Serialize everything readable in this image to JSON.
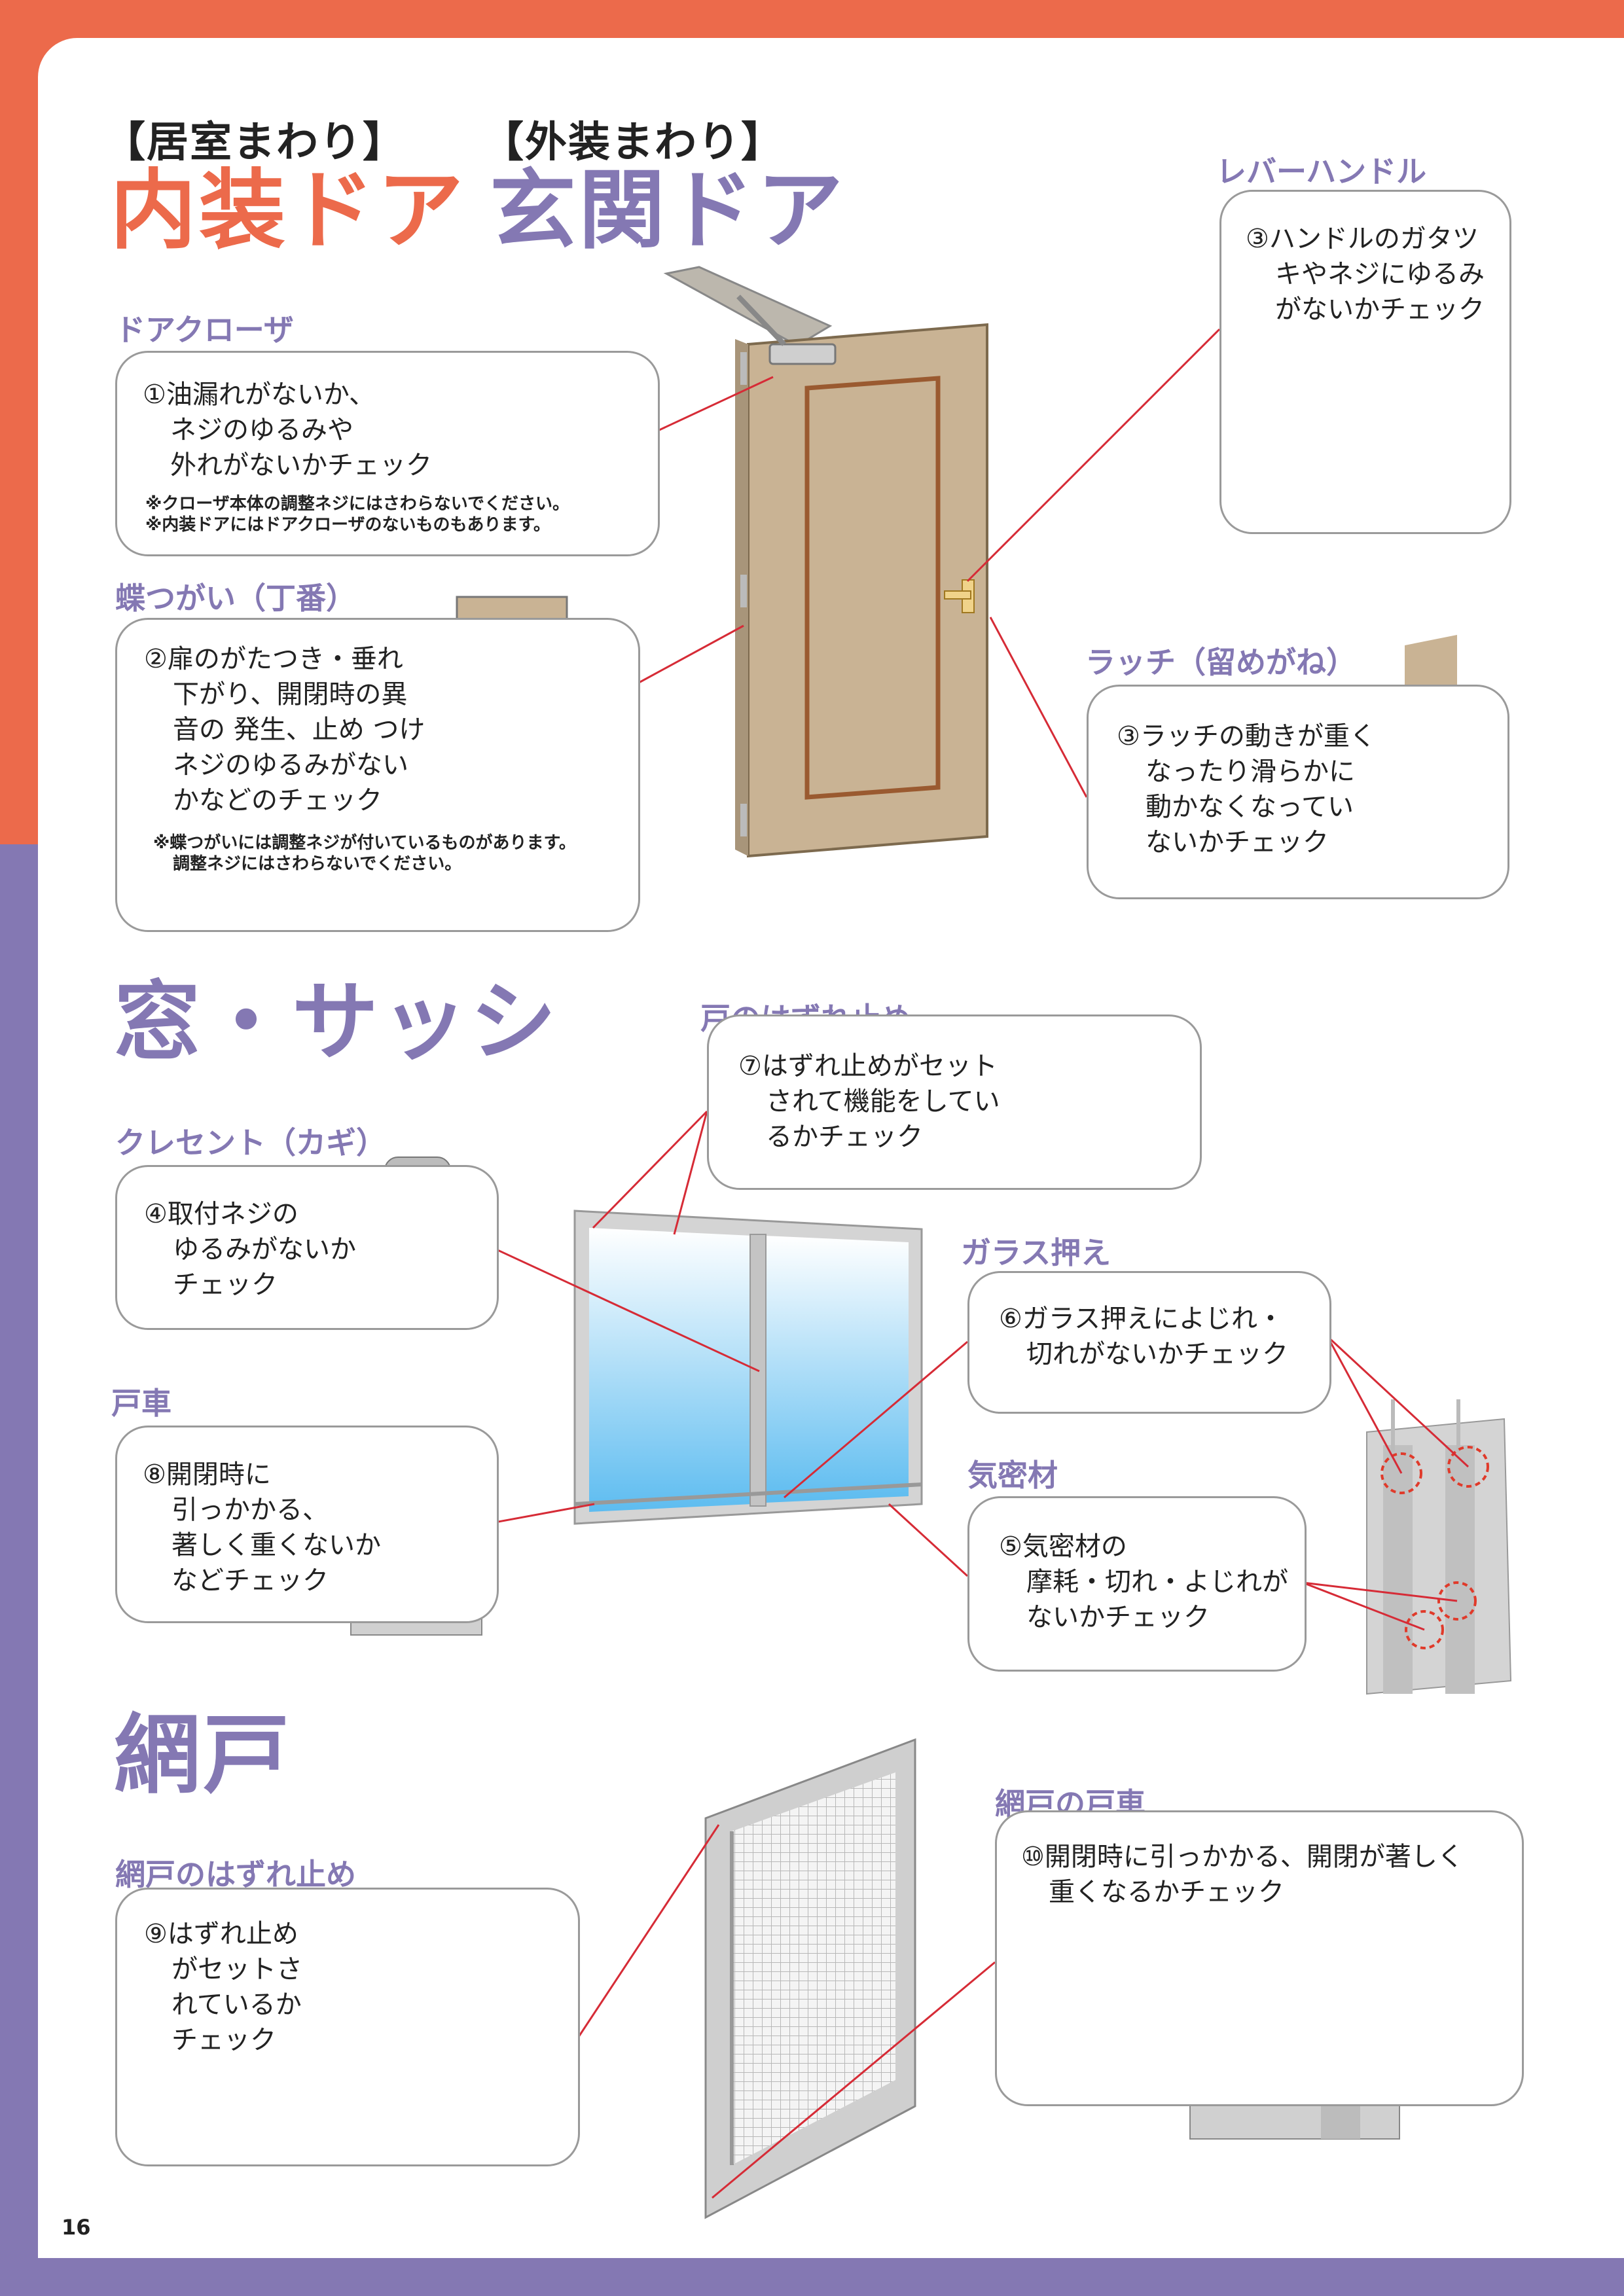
{
  "colors": {
    "orange": "#ec6a4b",
    "purple": "#8478b3",
    "door": "#c9b394",
    "red": "#d62b36"
  },
  "header": {
    "interior_cat": "【居室まわり】",
    "interior_title": "内装ドア",
    "exterior_cat": "【外装まわり】",
    "exterior_title": "玄関ドア"
  },
  "door": {
    "closer": {
      "label": "ドアクローザ",
      "lines": [
        "①油漏れがないか、",
        "ネジのゆるみや",
        "外れがないかチェック"
      ],
      "notes": [
        "※クローザ本体の調整ネジにはさわらないでください。",
        "※内装ドアにはドアクローザのないものもあります。"
      ]
    },
    "hinge": {
      "label": "蝶つがい（丁番）",
      "lines": [
        "②扉のがたつき・垂れ",
        "下がり、開閉時の異",
        "音の 発生、止め つけ",
        "ネジのゆるみがない",
        "かなどのチェック"
      ],
      "notes": [
        "※蝶つがいには調整ネジが付いているものがあります。",
        "調整ネジにはさわらないでください。"
      ]
    },
    "lever": {
      "label": "レバーハンドル",
      "lines": [
        "③ハンドルのガタツ",
        "キやネジにゆるみ",
        "がないかチェック"
      ]
    },
    "latch": {
      "label": "ラッチ（留めがね）",
      "lines": [
        "③ラッチの動きが重く",
        "なったり滑らかに",
        "動かなくなってい",
        "ないかチェック"
      ]
    }
  },
  "window": {
    "title": "窓・サッシ",
    "stopper": {
      "label": "戸のはずれ止め",
      "lines": [
        "⑦はずれ止めがセット",
        "されて機能をしてい",
        "るかチェック"
      ]
    },
    "crescent": {
      "label": "クレセント（カギ）",
      "lines": [
        "④取付ネジの",
        "ゆるみがないか",
        "チェック"
      ]
    },
    "glass": {
      "label": "ガラス押え",
      "lines": [
        "⑥ガラス押えによじれ・",
        "切れがないかチェック"
      ]
    },
    "roller": {
      "label": "戸車",
      "lines": [
        "⑧開閉時に",
        "引っかかる、",
        "著しく重くないか",
        "などチェック"
      ]
    },
    "seal": {
      "label": "気密材",
      "lines": [
        "⑤気密材の",
        "摩耗・切れ・よじれが",
        "ないかチェック"
      ]
    }
  },
  "screen": {
    "title": "網戸",
    "stopper": {
      "label": "網戸のはずれ止め",
      "lines": [
        "⑨はずれ止め",
        "がセットさ",
        "れているか",
        "チェック"
      ]
    },
    "roller": {
      "label": "網戸の戸車",
      "lines": [
        "⑩開閉時に引っかかる、開閉が著しく",
        "重くなるかチェック"
      ]
    }
  },
  "page_number": "16"
}
